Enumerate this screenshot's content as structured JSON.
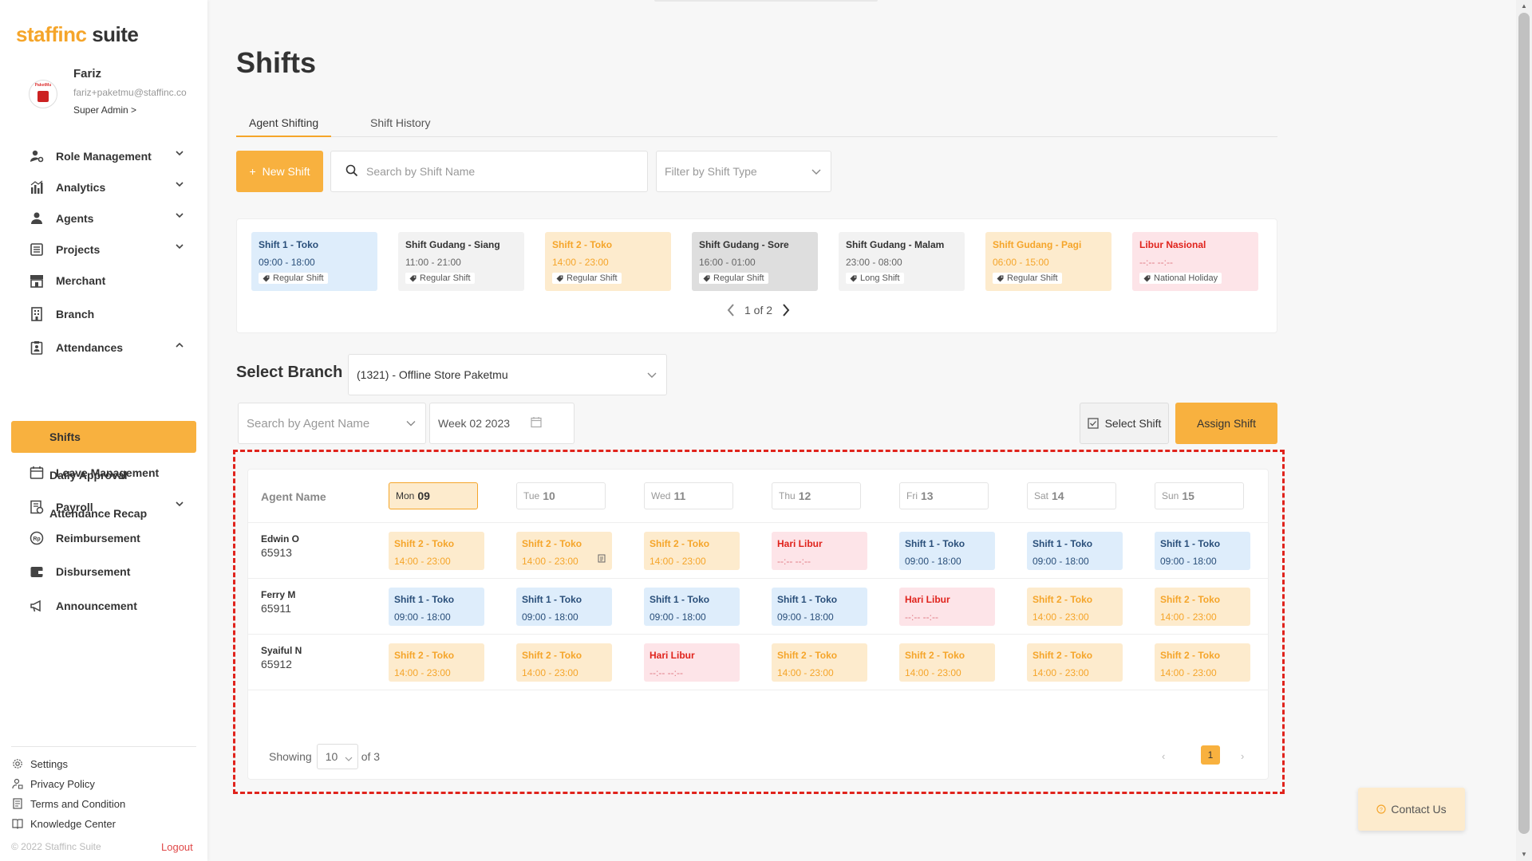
{
  "sidebar": {
    "logo_brand": "staffinc",
    "logo_suite": "suite",
    "profile": {
      "name": "Fariz",
      "email": "fariz+paketmu@staffinc.co",
      "role": "Super Admin >",
      "avatar_text": "PaketMu"
    },
    "nav": [
      {
        "label": "Role Management",
        "icon": "users-cog-icon",
        "has_chevron": true
      },
      {
        "label": "Analytics",
        "icon": "bar-chart-icon",
        "has_chevron": true
      },
      {
        "label": "Agents",
        "icon": "agents-icon",
        "has_chevron": true
      },
      {
        "label": "Projects",
        "icon": "projects-icon",
        "has_chevron": true
      },
      {
        "label": "Merchant",
        "icon": "store-icon",
        "has_chevron": false
      },
      {
        "label": "Branch",
        "icon": "building-icon",
        "has_chevron": false
      },
      {
        "label": "Attendances",
        "icon": "clipboard-icon",
        "has_chevron": true
      },
      {
        "label": "Leave Management",
        "icon": "calendar-icon",
        "has_chevron": false
      },
      {
        "label": "Payroll",
        "icon": "payroll-icon",
        "has_chevron": true
      },
      {
        "label": "Reimbursement",
        "icon": "rupiah-icon",
        "has_chevron": false
      },
      {
        "label": "Disbursement",
        "icon": "wallet-icon",
        "has_chevron": false
      },
      {
        "label": "Announcement",
        "icon": "megaphone-icon",
        "has_chevron": false
      }
    ],
    "attendance_sub": [
      {
        "label": "Shifts",
        "active": true
      },
      {
        "label": "Daily Approval",
        "active": false
      },
      {
        "label": "Attendance Recap",
        "active": false
      }
    ],
    "footer_links": [
      {
        "label": "Settings",
        "icon": "gear-icon"
      },
      {
        "label": "Privacy Policy",
        "icon": "privacy-icon"
      },
      {
        "label": "Terms and Condition",
        "icon": "document-icon"
      },
      {
        "label": "Knowledge Center",
        "icon": "book-icon"
      }
    ],
    "copyright": "© 2022 Staffinc Suite",
    "logout": "Logout"
  },
  "page": {
    "title": "Shifts",
    "tabs": [
      {
        "label": "Agent Shifting",
        "active": true
      },
      {
        "label": "Shift History",
        "active": false
      }
    ],
    "new_shift_label": "New Shift",
    "search_placeholder": "Search by Shift Name",
    "filter_placeholder": "Filter by Shift Type"
  },
  "shift_types": [
    {
      "name": "Shift 1 - Toko",
      "time": "09:00 - 18:00",
      "tag": "Regular Shift",
      "style": "blue"
    },
    {
      "name": "Shift Gudang - Siang",
      "time": "11:00 - 21:00",
      "tag": "Regular Shift",
      "style": "gray"
    },
    {
      "name": "Shift 2 - Toko",
      "time": "14:00 - 23:00",
      "tag": "Regular Shift",
      "style": "orange"
    },
    {
      "name": "Shift Gudang - Sore",
      "time": "16:00 - 01:00",
      "tag": "Regular Shift",
      "style": "darkgray"
    },
    {
      "name": "Shift Gudang - Malam",
      "time": "23:00 - 08:00",
      "tag": "Long Shift",
      "style": "gray"
    },
    {
      "name": "Shift Gudang - Pagi",
      "time": "06:00 - 15:00",
      "tag": "Regular Shift",
      "style": "orange"
    },
    {
      "name": "Libur Nasional",
      "time": "--:-- --:--",
      "tag": "National Holiday",
      "style": "red"
    }
  ],
  "shift_pager": "1 of 2",
  "branch": {
    "label": "Select Branch",
    "selected": "(1321) - Offline Store Paketmu"
  },
  "agent_search_placeholder": "Search by Agent Name",
  "week_value": "Week 02 2023",
  "select_shift_label": "Select Shift",
  "assign_shift_label": "Assign Shift",
  "table": {
    "agent_header": "Agent Name",
    "days": [
      {
        "dow": "Mon",
        "date": "09",
        "active": true
      },
      {
        "dow": "Tue",
        "date": "10",
        "active": false
      },
      {
        "dow": "Wed",
        "date": "11",
        "active": false
      },
      {
        "dow": "Thu",
        "date": "12",
        "active": false
      },
      {
        "dow": "Fri",
        "date": "13",
        "active": false
      },
      {
        "dow": "Sat",
        "date": "14",
        "active": false
      },
      {
        "dow": "Sun",
        "date": "15",
        "active": false
      }
    ],
    "rows": [
      {
        "name": "Edwin O",
        "id": "65913",
        "cells": [
          {
            "name": "Shift 2 - Toko",
            "time": "14:00 - 23:00",
            "style": "orange"
          },
          {
            "name": "Shift 2 - Toko",
            "time": "14:00 - 23:00",
            "style": "orange",
            "note": true
          },
          {
            "name": "Shift 2 - Toko",
            "time": "14:00 - 23:00",
            "style": "orange"
          },
          {
            "name": "Hari Libur",
            "time": "--:-- --:--",
            "style": "red"
          },
          {
            "name": "Shift 1 - Toko",
            "time": "09:00 - 18:00",
            "style": "blue"
          },
          {
            "name": "Shift 1 - Toko",
            "time": "09:00 - 18:00",
            "style": "blue"
          },
          {
            "name": "Shift 1 - Toko",
            "time": "09:00 - 18:00",
            "style": "blue"
          }
        ]
      },
      {
        "name": "Ferry M",
        "id": "65911",
        "cells": [
          {
            "name": "Shift 1 - Toko",
            "time": "09:00 - 18:00",
            "style": "blue"
          },
          {
            "name": "Shift 1 - Toko",
            "time": "09:00 - 18:00",
            "style": "blue"
          },
          {
            "name": "Shift 1 - Toko",
            "time": "09:00 - 18:00",
            "style": "blue"
          },
          {
            "name": "Shift 1 - Toko",
            "time": "09:00 - 18:00",
            "style": "blue"
          },
          {
            "name": "Hari Libur",
            "time": "--:-- --:--",
            "style": "red"
          },
          {
            "name": "Shift 2 - Toko",
            "time": "14:00 - 23:00",
            "style": "orange"
          },
          {
            "name": "Shift 2 - Toko",
            "time": "14:00 - 23:00",
            "style": "orange"
          }
        ]
      },
      {
        "name": "Syaiful N",
        "id": "65912",
        "cells": [
          {
            "name": "Shift 2 - Toko",
            "time": "14:00 - 23:00",
            "style": "orange"
          },
          {
            "name": "Shift 2 - Toko",
            "time": "14:00 - 23:00",
            "style": "orange"
          },
          {
            "name": "Hari Libur",
            "time": "--:-- --:--",
            "style": "red"
          },
          {
            "name": "Shift 2 - Toko",
            "time": "14:00 - 23:00",
            "style": "orange"
          },
          {
            "name": "Shift 2 - Toko",
            "time": "14:00 - 23:00",
            "style": "orange"
          },
          {
            "name": "Shift 2 - Toko",
            "time": "14:00 - 23:00",
            "style": "orange"
          },
          {
            "name": "Shift 2 - Toko",
            "time": "14:00 - 23:00",
            "style": "orange"
          }
        ]
      }
    ],
    "showing_label": "Showing",
    "page_size": "10",
    "of_label": "of 3",
    "current_page": "1"
  },
  "contact_label": "Contact Us",
  "colors": {
    "accent": "#f8b13f",
    "blue_bg": "#deedfb",
    "blue_text": "#2a4f7a",
    "orange_bg": "#fdebcd",
    "orange_text": "#f5a52a",
    "red_bg": "#fde4e8",
    "red_text": "#e0231c",
    "gray_bg": "#f2f2f2",
    "gray_text": "#333333",
    "darkgray_bg": "#dedede",
    "darkgray_text": "#333333",
    "highlight_border": "#e0231c"
  }
}
